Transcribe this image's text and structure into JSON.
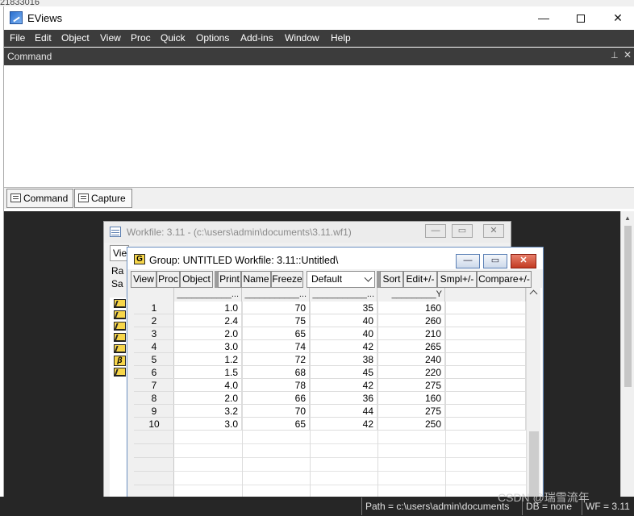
{
  "background": {
    "partial_text": "21833016"
  },
  "app": {
    "title": "EViews"
  },
  "window_controls": {
    "minimize": "—",
    "close": "✕"
  },
  "menu": [
    "File",
    "Edit",
    "Object",
    "View",
    "Proc",
    "Quick",
    "Options",
    "Add-ins",
    "Window",
    "Help"
  ],
  "command_pane": {
    "title": "Command",
    "pin": "⊥",
    "close": "✕"
  },
  "tabs": {
    "command": "Command",
    "capture": "Capture"
  },
  "workfile": {
    "title": "Workfile: 3.11 - (c:\\users\\admin\\documents\\3.11.wf1)",
    "view_button": "View",
    "range_label": "Ra",
    "sample_label": "Sa",
    "objects": [
      "series",
      "series",
      "series",
      "series",
      "series",
      "beta",
      "series"
    ]
  },
  "group": {
    "icon_letter": "G",
    "title": "Group: UNTITLED    Workfile: 3.11::Untitled\\",
    "toolbar": {
      "view": "View",
      "proc": "Proc",
      "object": "Object",
      "print": "Print",
      "name": "Name",
      "freeze": "Freeze",
      "display_format": "Default",
      "sort": "Sort",
      "edit": "Edit+/-",
      "smpl": "Smpl+/-",
      "compare": "Compare+/-"
    },
    "columns": [
      "___________...",
      "___________...",
      "___________...",
      "_________Y"
    ],
    "rows": [
      {
        "obs": "1",
        "c1": "1.0",
        "c2": "70",
        "c3": "35",
        "y": "160"
      },
      {
        "obs": "2",
        "c1": "2.4",
        "c2": "75",
        "c3": "40",
        "y": "260"
      },
      {
        "obs": "3",
        "c1": "2.0",
        "c2": "65",
        "c3": "40",
        "y": "210"
      },
      {
        "obs": "4",
        "c1": "3.0",
        "c2": "74",
        "c3": "42",
        "y": "265"
      },
      {
        "obs": "5",
        "c1": "1.2",
        "c2": "72",
        "c3": "38",
        "y": "240"
      },
      {
        "obs": "6",
        "c1": "1.5",
        "c2": "68",
        "c3": "45",
        "y": "220"
      },
      {
        "obs": "7",
        "c1": "4.0",
        "c2": "78",
        "c3": "42",
        "y": "275"
      },
      {
        "obs": "8",
        "c1": "2.0",
        "c2": "66",
        "c3": "36",
        "y": "160"
      },
      {
        "obs": "9",
        "c1": "3.2",
        "c2": "70",
        "c3": "44",
        "y": "275"
      },
      {
        "obs": "10",
        "c1": "3.0",
        "c2": "65",
        "c3": "42",
        "y": "250"
      }
    ]
  },
  "status": {
    "path": "Path = c:\\users\\admin\\documents",
    "db": "DB = none",
    "wf": "WF = 3.11"
  },
  "watermark": "CSDN @瑞雪流年"
}
